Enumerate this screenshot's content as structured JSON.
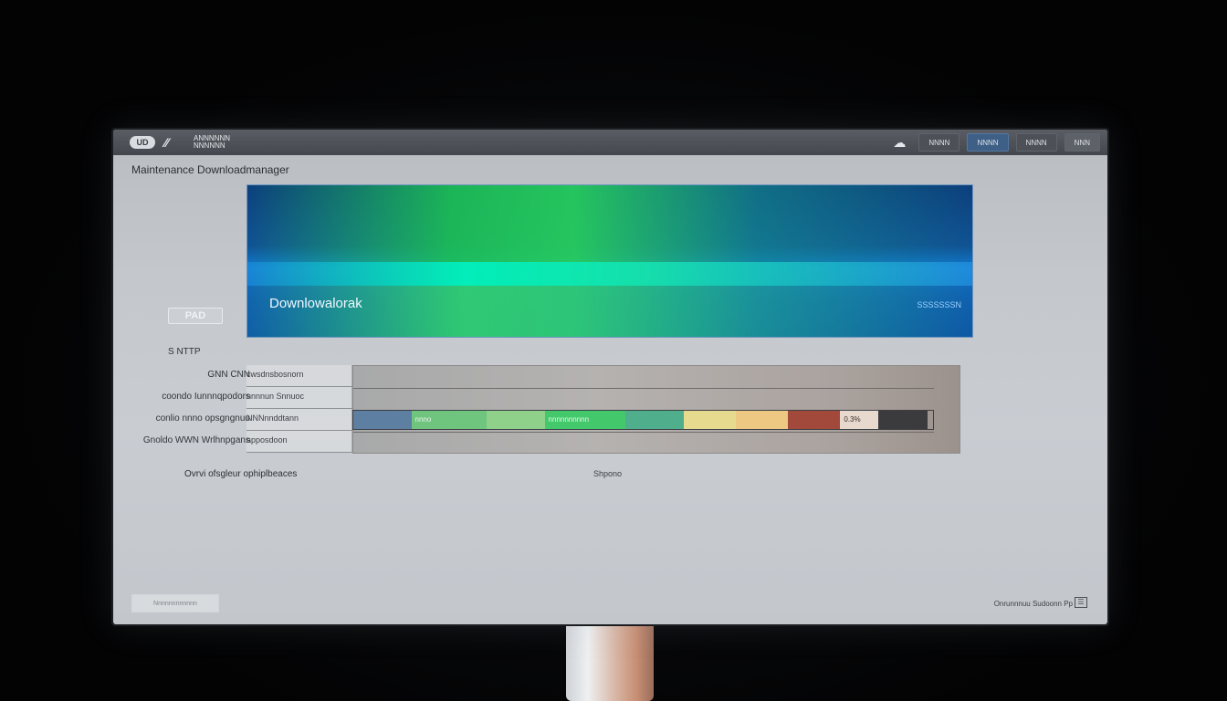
{
  "titlebar": {
    "logo": "UD",
    "brand_line": "ANNNNNN NNNNNN",
    "buttons": [
      "NNNN",
      "NNNN",
      "NNNN",
      "NNN"
    ]
  },
  "page": {
    "title": "Maintenance Downloadmanager"
  },
  "banner": {
    "title": "Downlowalorak",
    "tag": "SSSSSSSN"
  },
  "side": {
    "badge": "PAD",
    "label": "S NTTP"
  },
  "rows": [
    {
      "label": "GNN CNN",
      "value": "cwsdnsbosnorn"
    },
    {
      "label": "coondo Iunnnqpodors",
      "value": "nnnnun Snnuoc"
    },
    {
      "label": "conlio nnno opsgngnuu",
      "value": "NNNnnddtann"
    },
    {
      "label": "Gnoldo WWN Wrlhnpgans",
      "value": "apposdoon"
    }
  ],
  "segments": [
    {
      "label": "",
      "color": "#5d7fa2",
      "fraction": 0.1
    },
    {
      "label": "nnno",
      "color": "#6fc47e",
      "fraction": 0.13
    },
    {
      "label": "",
      "color": "#8fd08a",
      "fraction": 0.1
    },
    {
      "label": "nnnnnnnnnn",
      "color": "#43c96b",
      "fraction": 0.14
    },
    {
      "label": "",
      "color": "#4fae8c",
      "fraction": 0.1
    },
    {
      "label": "",
      "color": "#e6da8e",
      "fraction": 0.09
    },
    {
      "label": "",
      "color": "#ecc882",
      "fraction": 0.09
    },
    {
      "label": "",
      "color": "#a3493c",
      "fraction": 0.09
    },
    {
      "label": "0.3%",
      "color": "#e8d9cf",
      "fraction": 0.065
    },
    {
      "label": "",
      "color": "#3b3a3c",
      "fraction": 0.085
    }
  ],
  "captions": {
    "left": "Ovrvi ofsgleur ophiplbeaces",
    "center": "Shpono"
  },
  "footer": {
    "button": "Nnnnnnnnnnnn",
    "status": "Onrunnnuu Sudoonn Pp"
  }
}
